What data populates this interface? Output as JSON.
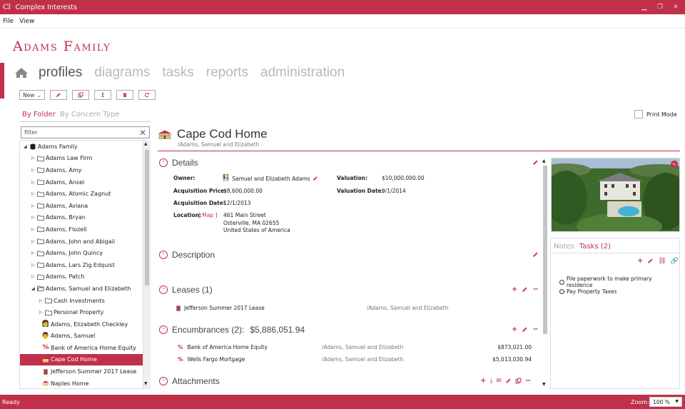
{
  "app": {
    "logo": "CI",
    "title": "Complex Interests"
  },
  "menu": [
    "File",
    "View"
  ],
  "family_title": "Adams Family",
  "nav": {
    "tabs": [
      "profiles",
      "diagrams",
      "tasks",
      "reports",
      "administration"
    ]
  },
  "toolbar": {
    "new_label": "New"
  },
  "left_panel": {
    "tabs": [
      "By Folder",
      "By Concern Type"
    ],
    "filter_value": "filter",
    "tree": [
      {
        "label": "Adams Family",
        "level": 0,
        "expand": "open",
        "icon": "database-icon"
      },
      {
        "label": "Adams Law Firm",
        "level": 1,
        "expand": "closed",
        "icon": "folder-icon"
      },
      {
        "label": "Adams, Amy",
        "level": 1,
        "expand": "closed",
        "icon": "folder-icon"
      },
      {
        "label": "Adams, Ansel",
        "level": 1,
        "expand": "closed",
        "icon": "folder-icon"
      },
      {
        "label": "Adams, Atomic Zagnut",
        "level": 1,
        "expand": "closed",
        "icon": "folder-icon"
      },
      {
        "label": "Adams, Aviana",
        "level": 1,
        "expand": "closed",
        "icon": "folder-icon"
      },
      {
        "label": "Adams, Bryan",
        "level": 1,
        "expand": "closed",
        "icon": "folder-icon"
      },
      {
        "label": "Adams, Flozell",
        "level": 1,
        "expand": "closed",
        "icon": "folder-icon"
      },
      {
        "label": "Adams, John and Abigail",
        "level": 1,
        "expand": "closed",
        "icon": "folder-icon"
      },
      {
        "label": "Adams, John Quincy",
        "level": 1,
        "expand": "closed",
        "icon": "folder-icon"
      },
      {
        "label": "Adams, Lars Zig Edquist",
        "level": 1,
        "expand": "closed",
        "icon": "folder-icon"
      },
      {
        "label": "Adams, Patch",
        "level": 1,
        "expand": "closed",
        "icon": "folder-icon"
      },
      {
        "label": "Adams, Samuel and Elizabeth",
        "level": 1,
        "expand": "open",
        "icon": "folder-open-icon"
      },
      {
        "label": "Cash Investments",
        "level": 2,
        "expand": "closed",
        "icon": "folder-icon"
      },
      {
        "label": "Personal Property",
        "level": 2,
        "expand": "closed",
        "icon": "folder-icon"
      },
      {
        "label": "Adams, Elizabeth Checkley",
        "level": 2,
        "expand": "none",
        "icon": "person-female-icon"
      },
      {
        "label": "Adams, Samuel",
        "level": 2,
        "expand": "none",
        "icon": "person-male-icon"
      },
      {
        "label": "Bank of America Home Equity",
        "level": 2,
        "expand": "none",
        "icon": "percent-icon"
      },
      {
        "label": "Cape Cod Home",
        "level": 2,
        "expand": "none",
        "icon": "house-icon",
        "selected": true
      },
      {
        "label": "Jefferson Summer 2017 Lease",
        "level": 2,
        "expand": "none",
        "icon": "lease-icon"
      },
      {
        "label": "Naples Home",
        "level": 2,
        "expand": "none",
        "icon": "house-icon"
      }
    ]
  },
  "print_mode_label": "Print Mode",
  "profile": {
    "title": "Cape Cod Home",
    "path": "/Adams, Samuel and Elizabeth",
    "details": {
      "header": "Details",
      "owner_label": "Owner:",
      "owner_value": "Samuel and Elizabeth Adams",
      "valuation_label": "Valuation:",
      "valuation_value": "$10,000,000.00",
      "acq_price_label": "Acquisition Price:",
      "acq_price_value": "$8,600,000.00",
      "valuation_date_label": "Valuation Date:",
      "valuation_date_value": "9/1/2014",
      "acq_date_label": "Acquisition Date:",
      "acq_date_value": "12/1/2013",
      "location_label": "Location:",
      "map_link": "[ Map ]",
      "address": [
        "461 Main Street",
        "Osterville, MA 02655",
        "United States of America"
      ]
    },
    "description_header": "Description",
    "leases": {
      "header": "Leases (1)",
      "items": [
        {
          "name": "Jefferson Summer 2017 Lease",
          "path": "/Adams, Samuel and Elizabeth"
        }
      ]
    },
    "encumbrances": {
      "header": "Encumbrances (2):",
      "total": "$5,886,051.94",
      "items": [
        {
          "name": "Bank of America Home Equity",
          "path": "/Adams, Samuel and Elizabeth",
          "amount": "$873,021.00"
        },
        {
          "name": "Wells Fargo Mortgage",
          "path": "/Adams, Samuel and Elizabeth",
          "amount": "$5,013,030.94"
        }
      ]
    },
    "attachments_header": "Attachments"
  },
  "right_panel": {
    "tabs": [
      "Notes",
      "Tasks (2)"
    ],
    "tasks": [
      "File paperwork to make primary residence",
      "Pay Property Taxes"
    ]
  },
  "status": {
    "text": "Ready",
    "zoom_label": "Zoom:",
    "zoom_value": "100 %"
  },
  "colors": {
    "accent": "#c0304a"
  }
}
